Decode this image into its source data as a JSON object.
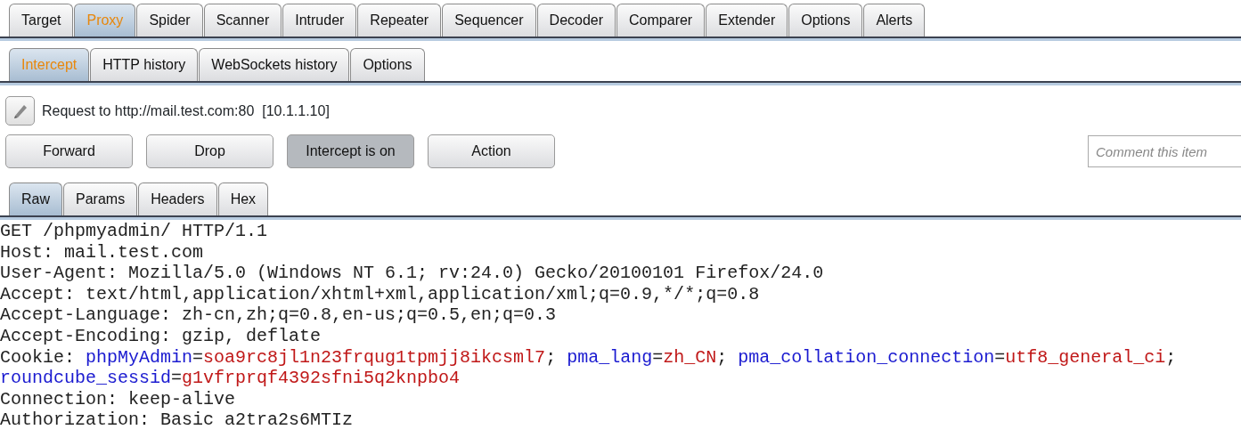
{
  "main_tabs": [
    {
      "label": "Target",
      "selected": false
    },
    {
      "label": "Proxy",
      "selected": true
    },
    {
      "label": "Spider",
      "selected": false
    },
    {
      "label": "Scanner",
      "selected": false
    },
    {
      "label": "Intruder",
      "selected": false
    },
    {
      "label": "Repeater",
      "selected": false
    },
    {
      "label": "Sequencer",
      "selected": false
    },
    {
      "label": "Decoder",
      "selected": false
    },
    {
      "label": "Comparer",
      "selected": false
    },
    {
      "label": "Extender",
      "selected": false
    },
    {
      "label": "Options",
      "selected": false
    },
    {
      "label": "Alerts",
      "selected": false
    }
  ],
  "proxy_tabs": [
    {
      "label": "Intercept",
      "selected": true
    },
    {
      "label": "HTTP history",
      "selected": false
    },
    {
      "label": "WebSockets history",
      "selected": false
    },
    {
      "label": "Options",
      "selected": false
    }
  ],
  "request_info": "Request to http://mail.test.com:80  [10.1.1.10]",
  "buttons": [
    {
      "label": "Forward",
      "pressed": false
    },
    {
      "label": "Drop",
      "pressed": false
    },
    {
      "label": "Intercept is on",
      "pressed": true
    },
    {
      "label": "Action",
      "pressed": false
    }
  ],
  "comment": {
    "placeholder": "Comment this item"
  },
  "message_tabs": [
    {
      "label": "Raw",
      "selected": true
    },
    {
      "label": "Params",
      "selected": false
    },
    {
      "label": "Headers",
      "selected": false
    },
    {
      "label": "Hex",
      "selected": false
    }
  ],
  "request_lines": [
    [
      {
        "kind": "plain",
        "text": "GET /phpmyadmin/ HTTP/1.1"
      }
    ],
    [
      {
        "kind": "plain",
        "text": "Host: mail.test.com"
      }
    ],
    [
      {
        "kind": "plain",
        "text": "User-Agent: Mozilla/5.0 (Windows NT 6.1; rv:24.0) Gecko/20100101 Firefox/24.0"
      }
    ],
    [
      {
        "kind": "plain",
        "text": "Accept: text/html,application/xhtml+xml,application/xml;q=0.9,*/*;q=0.8"
      }
    ],
    [
      {
        "kind": "plain",
        "text": "Accept-Language: zh-cn,zh;q=0.8,en-us;q=0.5,en;q=0.3"
      }
    ],
    [
      {
        "kind": "plain",
        "text": "Accept-Encoding: gzip, deflate"
      }
    ],
    [
      {
        "kind": "plain",
        "text": "Cookie: "
      },
      {
        "kind": "name",
        "text": "phpMyAdmin"
      },
      {
        "kind": "plain",
        "text": "="
      },
      {
        "kind": "value",
        "text": "soa9rc8jl1n23frqug1tpmjj8ikcsml7"
      },
      {
        "kind": "plain",
        "text": "; "
      },
      {
        "kind": "name",
        "text": "pma_lang"
      },
      {
        "kind": "plain",
        "text": "="
      },
      {
        "kind": "value",
        "text": "zh_CN"
      },
      {
        "kind": "plain",
        "text": "; "
      },
      {
        "kind": "name",
        "text": "pma_collation_connection"
      },
      {
        "kind": "plain",
        "text": "="
      },
      {
        "kind": "value",
        "text": "utf8_general_ci"
      },
      {
        "kind": "plain",
        "text": ";"
      }
    ],
    [
      {
        "kind": "name",
        "text": "roundcube_sessid"
      },
      {
        "kind": "plain",
        "text": "="
      },
      {
        "kind": "value",
        "text": "g1vfrprqf4392sfni5q2knpbo4"
      }
    ],
    [
      {
        "kind": "plain",
        "text": "Connection: keep-alive"
      }
    ],
    [
      {
        "kind": "plain",
        "text": "Authorization: Basic a2tra2s6MTIz"
      }
    ]
  ]
}
